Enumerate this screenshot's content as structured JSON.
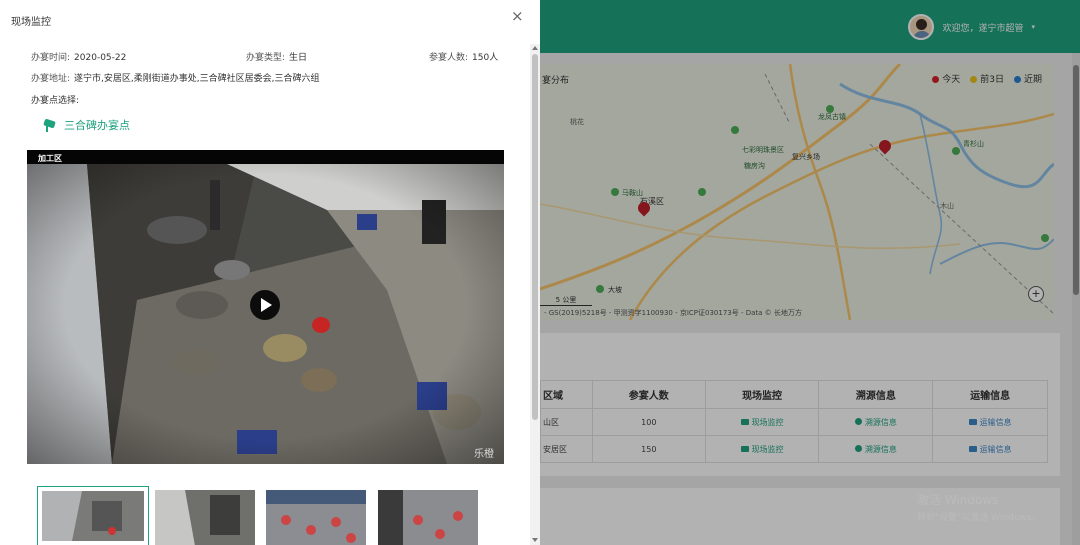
{
  "header": {
    "greeting": "欢迎您，遂宁市超管",
    "caret": "▾"
  },
  "map": {
    "title": "宴分布",
    "legend": [
      {
        "label": "今天",
        "color": "#d6202a"
      },
      {
        "label": "前3日",
        "color": "#e8c21a"
      },
      {
        "label": "近期",
        "color": "#2a7fd4"
      }
    ],
    "scale_label": "5 公里",
    "attribution": "- GS(2019)5218号 - 甲测资字1100930 - 京ICP证030173号 - Data © 长地万方",
    "zoom_label": "+",
    "places": [
      "马鞍山",
      "七彩明珠景区",
      "糖房沟",
      "复兴乡场",
      "龙凤古镇",
      "青杉山",
      "石溪区",
      "桃花",
      "大坡",
      "木山"
    ]
  },
  "table": {
    "headers": [
      "区域",
      "参宴人数",
      "现场监控",
      "溯源信息",
      "运输信息"
    ],
    "rows": [
      {
        "area": "山区",
        "count": "100",
        "monitor": "现场监控",
        "trace": "溯源信息",
        "transport": "运输信息"
      },
      {
        "area": "安居区",
        "count": "150",
        "monitor": "现场监控",
        "trace": "溯源信息",
        "transport": "运输信息"
      }
    ]
  },
  "watermark": {
    "line1": "激活 Windows",
    "line2": "转到\"设置\"以激活 Windows。"
  },
  "modal": {
    "title": "现场监控",
    "close": "×",
    "date_label": "办宴时间:",
    "date_value": "2020-05-22",
    "type_label": "办宴类型:",
    "type_value": "生日",
    "people_label": "参宴人数:",
    "people_value": "150人",
    "address_label": "办宴地址:",
    "address_value": "遂宁市,安居区,柔刚街道办事处,三合碑社区居委会,三合碑六组",
    "point_label": "办宴点选择:",
    "point_name": "三合碑办宴点",
    "video_label": "加工区",
    "video_stamp": "乐橙"
  }
}
